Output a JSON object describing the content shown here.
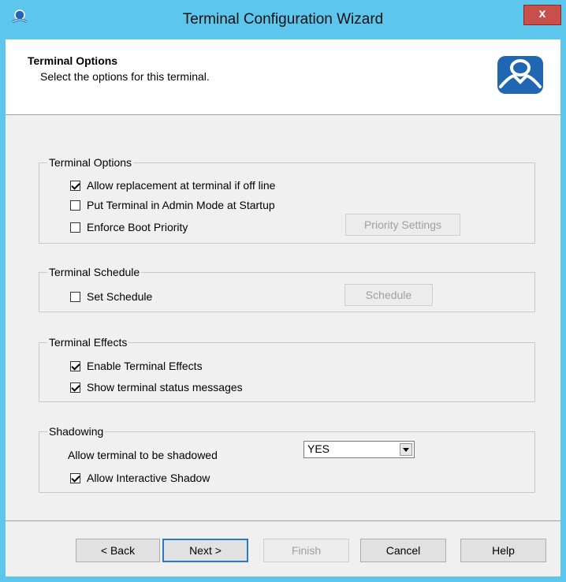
{
  "window": {
    "title": "Terminal Configuration Wizard",
    "close_label": "x"
  },
  "header": {
    "title": "Terminal Options",
    "subtitle": "Select the options for this terminal."
  },
  "groups": {
    "terminal_options": {
      "title": "Terminal Options",
      "items": [
        {
          "label": "Allow replacement at terminal if off line",
          "checked": true
        },
        {
          "label": "Put Terminal in Admin Mode at Startup",
          "checked": false
        },
        {
          "label": "Enforce Boot Priority",
          "checked": false
        }
      ],
      "priority_button": "Priority Settings"
    },
    "terminal_schedule": {
      "title": "Terminal Schedule",
      "items": [
        {
          "label": "Set Schedule",
          "checked": false
        }
      ],
      "schedule_button": "Schedule"
    },
    "terminal_effects": {
      "title": "Terminal Effects",
      "items": [
        {
          "label": "Enable Terminal Effects",
          "checked": true
        },
        {
          "label": "Show terminal status messages",
          "checked": true
        }
      ]
    },
    "shadowing": {
      "title": "Shadowing",
      "shadow_label": "Allow terminal to be shadowed",
      "shadow_value": "YES",
      "items": [
        {
          "label": "Allow Interactive Shadow",
          "checked": true
        }
      ]
    }
  },
  "footer": {
    "back": "< Back",
    "next": "Next >",
    "finish": "Finish",
    "cancel": "Cancel",
    "help": "Help"
  },
  "colors": {
    "titlebar": "#5cc6ec",
    "close": "#c7504a",
    "logo": "#1f66b3"
  },
  "icons": {
    "app": "terminal-app-icon",
    "logo": "thinmanager-logo-icon",
    "close": "close-icon"
  }
}
